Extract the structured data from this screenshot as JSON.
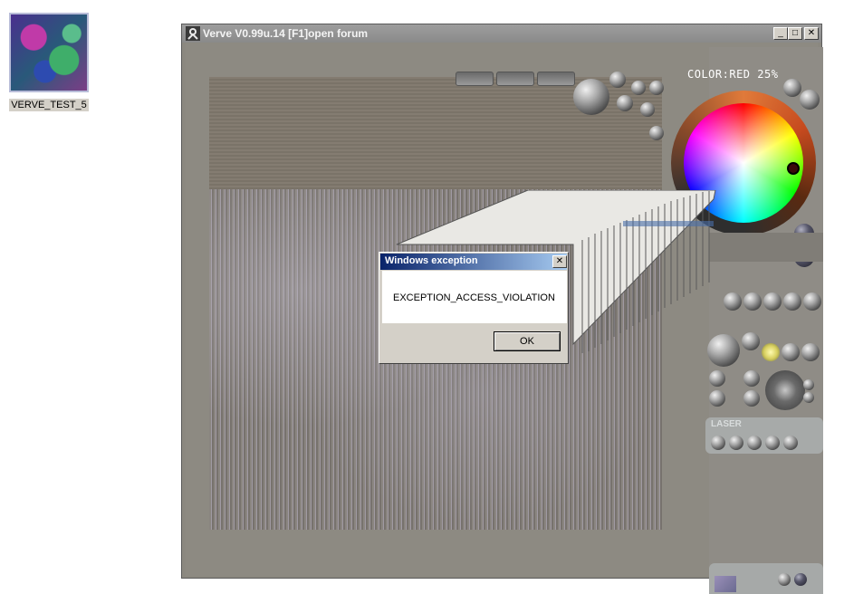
{
  "desktop": {
    "icon_label": "VERVE_TEST_5"
  },
  "window": {
    "title": "Verve V0.99u.14 [F1]open forum",
    "min_glyph": "_",
    "max_glyph": "□",
    "close_glyph": "✕"
  },
  "app": {
    "color_readout": "COLOR:RED  25%",
    "laser_label": "LASER"
  },
  "dialog": {
    "title": "Windows exception",
    "message": "EXCEPTION_ACCESS_VIOLATION",
    "ok_label": "OK",
    "close_glyph": "✕"
  }
}
